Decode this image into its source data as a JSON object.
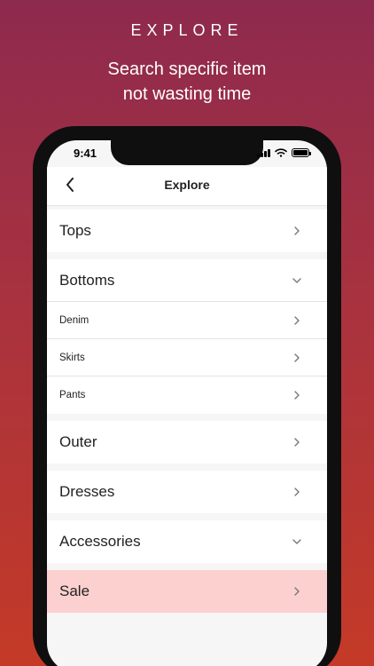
{
  "promo": {
    "title": "EXPLORE",
    "subtitle_line1": "Search specific item",
    "subtitle_line2": "not wasting time"
  },
  "status_bar": {
    "time": "9:41"
  },
  "nav": {
    "title": "Explore",
    "back_icon": "chevron-left-icon"
  },
  "categories": {
    "tops": "Tops",
    "bottoms": "Bottoms",
    "bottoms_items": [
      "Denim",
      "Skirts",
      "Pants"
    ],
    "outer": "Outer",
    "dresses": "Dresses",
    "accessories": "Accessories",
    "sale": "Sale"
  },
  "colors": {
    "sale_highlight": "#fdd0d0",
    "gradient_top": "#8e2a4e",
    "gradient_bottom": "#c43a27"
  }
}
